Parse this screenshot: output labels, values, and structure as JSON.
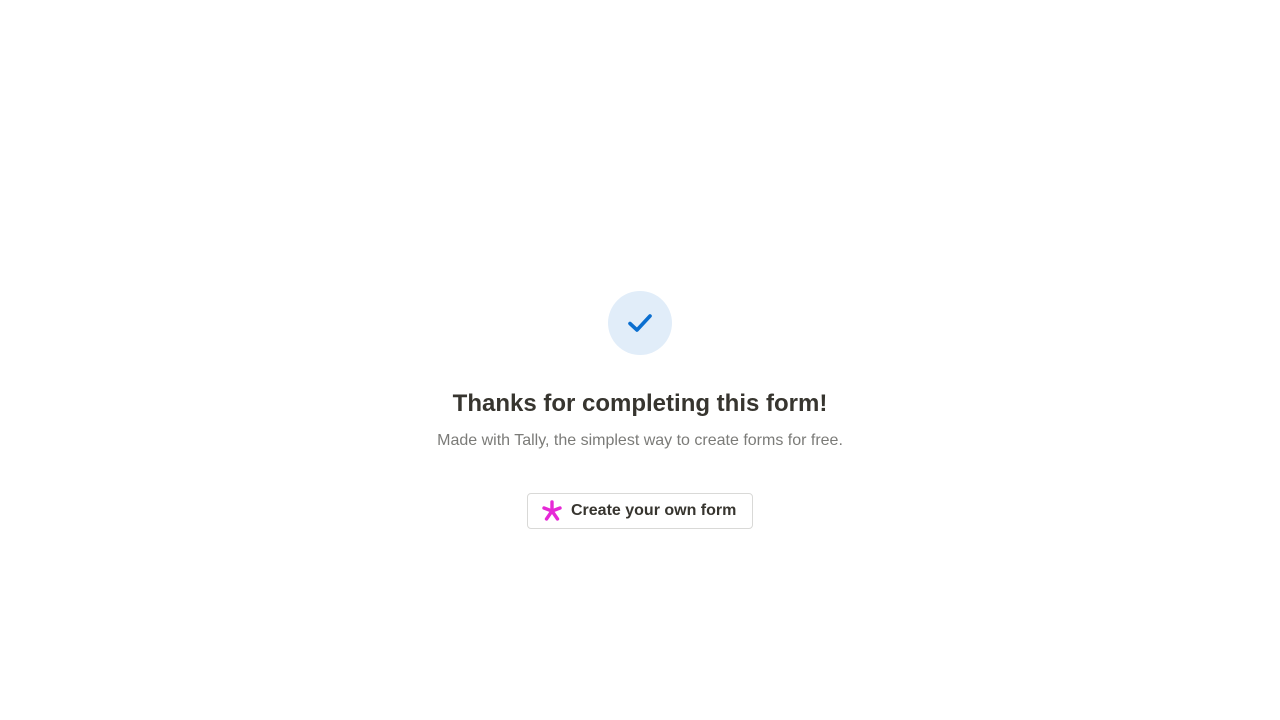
{
  "confirmation": {
    "icon": "checkmark-icon",
    "title": "Thanks for completing this form!",
    "subtitle": "Made with Tally, the simplest way to create forms for free."
  },
  "cta": {
    "icon": "tally-asterisk-icon",
    "label": "Create your own form"
  },
  "colors": {
    "check_bg": "#e1edf9",
    "check_fg": "#0b6fd0",
    "title": "#37352f",
    "subtitle": "#7b7b78",
    "asterisk": "#e629d6"
  }
}
